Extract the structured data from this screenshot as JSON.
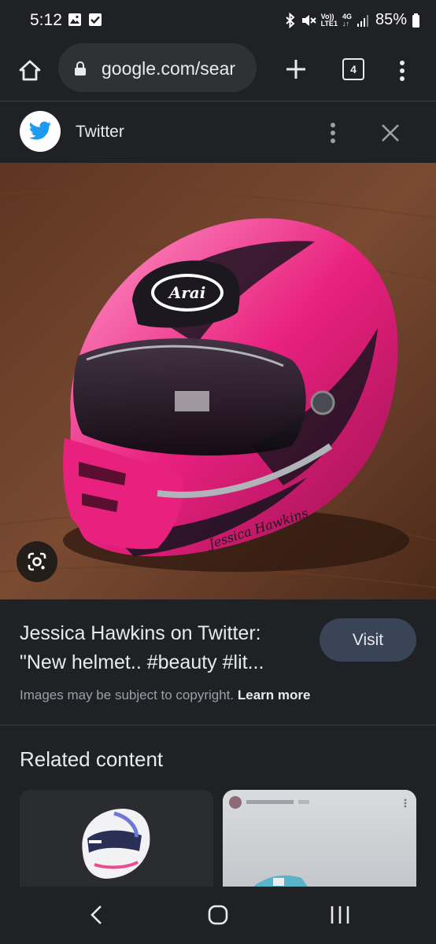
{
  "status_bar": {
    "time": "5:12",
    "network_top": "Vo))",
    "network_bottom": "LTE1",
    "generation": "4G",
    "battery": "85%"
  },
  "toolbar": {
    "url": "google.com/sear",
    "tab_count": "4"
  },
  "source": {
    "name": "Twitter"
  },
  "result": {
    "title": "Jessica Hawkins on Twitter: \"New helmet.. #beauty #lit...",
    "visit_label": "Visit",
    "copyright_text": "Images may be subject to copyright.",
    "learn_more": "Learn more"
  },
  "related": {
    "heading": "Related content"
  },
  "image_text": {
    "brand": "Arai",
    "helmet_name": "Jessica Hawkins"
  },
  "colors": {
    "background": "#202124",
    "accent_pink": "#e8207e",
    "twitter_blue": "#1d9bf0",
    "visit_button": "#394457"
  },
  "icons": {
    "home": "home-icon",
    "lock": "lock-icon",
    "new_tab": "plus-icon",
    "menu": "more-vertical-icon",
    "close": "close-icon",
    "lens": "google-lens-icon",
    "back": "back-icon"
  }
}
